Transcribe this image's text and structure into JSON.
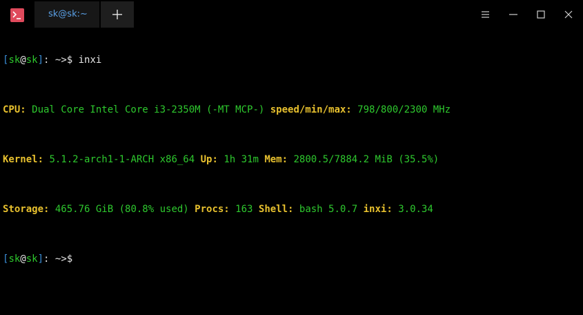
{
  "window": {
    "tab_title": "sk@sk:~",
    "icons": {
      "app": "terminal-icon",
      "new_tab": "plus-icon",
      "menu": "hamburger-menu-icon",
      "minimize": "minimize-icon",
      "maximize": "maximize-icon",
      "close": "close-icon"
    }
  },
  "colors": {
    "bracket": "#3a8fd8",
    "host": "#2ec92e",
    "label": "#e7c02e",
    "value": "#2ec92e",
    "tab_text": "#5aa0e6",
    "app_icon": "#e04a5c"
  },
  "terminal": {
    "prompt": {
      "open": "[",
      "user": "sk",
      "at": "@",
      "host": "sk",
      "close": "]",
      "path": ": ~>$"
    },
    "command": " inxi",
    "lines": [
      [
        {
          "k": "CPU:",
          "v": " Dual Core Intel Core i3-2350M (-MT MCP-) "
        },
        {
          "k": "speed/min/max:",
          "v": " 798/800/2300 MHz"
        }
      ],
      [
        {
          "k": "Kernel:",
          "v": " 5.1.2-arch1-1-ARCH x86_64 "
        },
        {
          "k": "Up:",
          "v": " 1h 31m "
        },
        {
          "k": "Mem:",
          "v": " 2800.5/7884.2 MiB (35.5%)"
        }
      ],
      [
        {
          "k": "Storage:",
          "v": " 465.76 GiB (80.8% used) "
        },
        {
          "k": "Procs:",
          "v": " 163 "
        },
        {
          "k": "Shell:",
          "v": " bash 5.0.7 "
        },
        {
          "k": "inxi:",
          "v": " 3.0.34"
        }
      ]
    ]
  }
}
